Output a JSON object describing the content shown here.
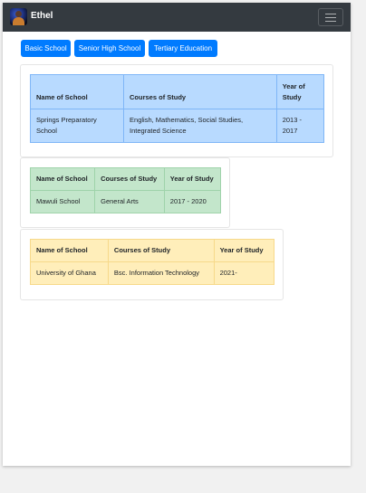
{
  "navbar": {
    "brand": "Ethel"
  },
  "tabs": [
    {
      "label": "Basic School"
    },
    {
      "label": "Senior High School"
    },
    {
      "label": "Tertiary Education"
    }
  ],
  "basic": {
    "headers": [
      "Name of School",
      "Courses of Study",
      "Year of Study"
    ],
    "row": [
      "Springs Preparatory School",
      "English, Mathematics, Social Studies, Integrated Science",
      "2013 - 2017"
    ]
  },
  "shs": {
    "headers": [
      "Name of School",
      "Courses of Study",
      "Year of Study"
    ],
    "row": [
      "Mawuli School",
      "General Arts",
      "2017 - 2020"
    ]
  },
  "tertiary": {
    "headers": [
      "Name of School",
      "Courses of Study",
      "Year of Study"
    ],
    "row": [
      "University of Ghana",
      "Bsc. Information Technology",
      "2021-"
    ]
  }
}
